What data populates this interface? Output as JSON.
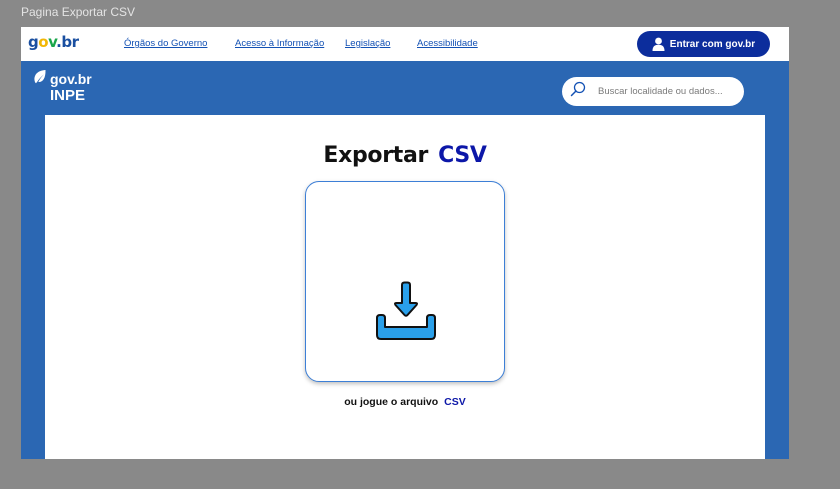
{
  "frame_title": "Pagina Exportar CSV",
  "header": {
    "logo": {
      "g": "g",
      "o": "o",
      "v": "v",
      "dot": ".",
      "br": "br"
    },
    "links": [
      "Órgãos do Governo",
      "Acesso à Informação",
      "Legislação",
      "Acessibilidade"
    ],
    "login_label": "Entrar com gov.br"
  },
  "brand": {
    "name": "gov.br",
    "subtitle": "INPE"
  },
  "search": {
    "placeholder": "Buscar localidade ou dados..."
  },
  "main": {
    "title_prefix": "Exportar",
    "title_accent": "CSV",
    "hint_prefix": "ou jogue o arquivo",
    "hint_accent": "CSV"
  },
  "colors": {
    "header_bg": "#ffffff",
    "band_bg": "#2b67b3",
    "login_bg": "#0c2d9c",
    "accent": "#0c17a8",
    "icon": "#2aa0ea"
  },
  "icons": {
    "user": "user-icon",
    "leaf": "leaf-icon",
    "search": "search-icon",
    "download": "download-icon"
  }
}
